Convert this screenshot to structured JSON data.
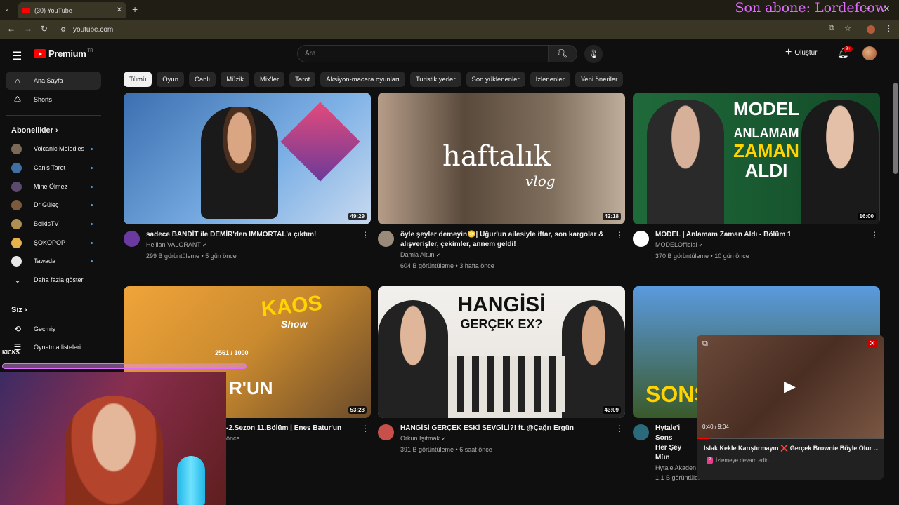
{
  "browser": {
    "tab_title": "(30) YouTube",
    "url": "youtube.com",
    "stream_overlay": "Son abone: Lordefcow"
  },
  "header": {
    "logo_text": "Premium",
    "logo_sup": "TR",
    "search_placeholder": "Ara",
    "create_label": "Oluştur",
    "notif_count": "9+"
  },
  "sidebar": {
    "main": [
      {
        "label": "Ana Sayfa",
        "icon": "home-icon"
      },
      {
        "label": "Shorts",
        "icon": "shorts-icon"
      }
    ],
    "subscriptions_header": "Abonelikler",
    "subscriptions": [
      {
        "label": "Volcanic Melodies",
        "color": "#7a6a55"
      },
      {
        "label": "Can's Tarot",
        "color": "#3f6fa3"
      },
      {
        "label": "Mine Ölmez",
        "color": "#5b4a6e"
      },
      {
        "label": "Dr Güleç",
        "color": "#7a5a3a"
      },
      {
        "label": "BelkisTV",
        "color": "#b09050"
      },
      {
        "label": "ŞOKOPOP",
        "color": "#e9b24a"
      },
      {
        "label": "Tawada",
        "color": "#e8e8e8"
      }
    ],
    "show_more": "Daha fazla göster",
    "you_header": "Siz",
    "you_items": [
      {
        "label": "Geçmiş"
      },
      {
        "label": "Oynatma listeleri"
      }
    ]
  },
  "chips": [
    "Tümü",
    "Oyun",
    "Canlı",
    "Müzik",
    "Mix'ler",
    "Tarot",
    "Aksiyon-macera oyunları",
    "Turistik yerler",
    "Son yüklenenler",
    "İzlenenler",
    "Yeni öneriler"
  ],
  "videos": [
    {
      "title": "sadece BANDİT ile DEMİR'den IMMORTAL'a çıktım!",
      "channel": "Hellian VALORANT",
      "stats": "299 B görüntüleme • 5 gün önce",
      "duration": "49:29",
      "thumb_color": "#3b6fb0"
    },
    {
      "title": "öyle şeyler demeyin😳| Uğur'un ailesiyle iftar, son kargolar & alışverişler, çekimler, annem geldi!",
      "channel": "Damla Altun",
      "stats": "604 B görüntüleme • 3 hafta önce",
      "duration": "42:18",
      "thumb_color": "#8a7a6a",
      "thumb_text": "haftalık",
      "thumb_text2": "vlog"
    },
    {
      "title": "MODEL | Anlamam Zaman Aldı - Bölüm 1",
      "channel": "MODELOfficial",
      "stats": "370 B görüntüleme • 10 gün önce",
      "duration": "16:00",
      "thumb_color": "#1f6a3a",
      "thumb_text": "MODEL",
      "thumb_text2": "ANLAMAM",
      "thumb_text3": "ZAMAN",
      "thumb_text4": "ALDI"
    },
    {
      "title": "-2.Sezon 11.Bölüm | Enes Batur'un",
      "channel": "",
      "stats": "önce",
      "duration": "53:28",
      "thumb_color": "#c98a2e",
      "thumb_text": "KAOS",
      "thumb_text2": "Show",
      "thumb_text3": "R'UN"
    },
    {
      "title": "HANGİSİ GERÇEK ESKİ SEVGİLİ?! ft. @Çağrı Ergün",
      "channel": "Orkun Işıtmak",
      "stats": "391 B görüntüleme • 6 saat önce",
      "duration": "43:09",
      "thumb_color": "#e6e2dc",
      "thumb_text": "HANGİSİ",
      "thumb_text2": "GERÇEK EX?"
    },
    {
      "title": "Hytale'i Sons Her Şey Mün",
      "channel": "Hytale Akaden",
      "stats": "1,1 B görüntüleme",
      "duration": "",
      "thumb_color": "#3a5a2a",
      "thumb_text": "SONS"
    }
  ],
  "mini_player": {
    "time": "0:40 / 9:04",
    "title": "Islak Kekle Karıştırmayın ❌ Gerçek Brownie Böyle Olur ...",
    "subtitle": "İzlemeye devam edin",
    "progress": 0.07
  },
  "overlay": {
    "kick_label": "KICKS",
    "kick_counter": "2561 / 1000"
  }
}
